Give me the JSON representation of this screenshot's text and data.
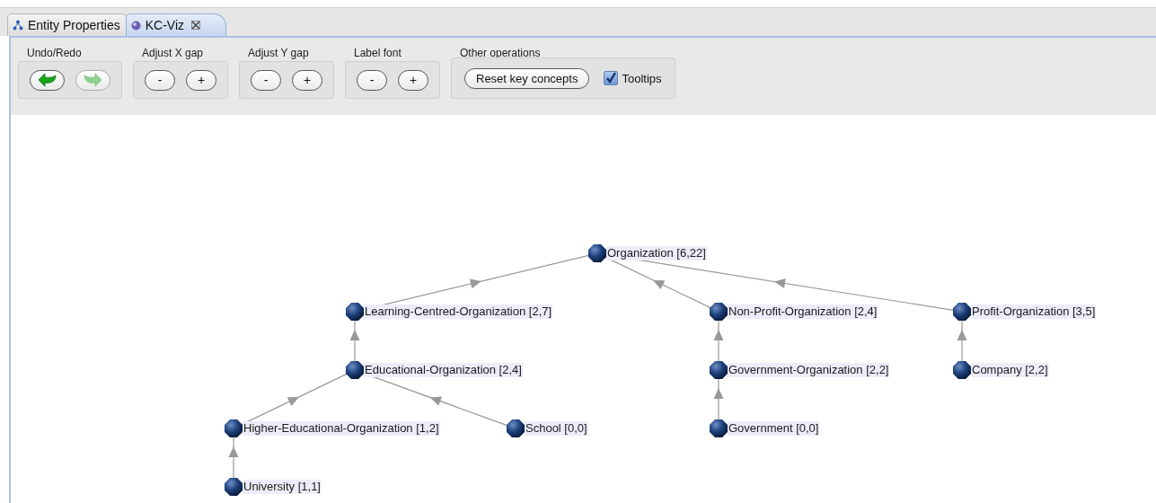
{
  "tabs": [
    {
      "label": "Entity Properties",
      "selected": false,
      "closable": false
    },
    {
      "label": "KC-Viz",
      "selected": true,
      "closable": true
    }
  ],
  "toolbar": {
    "groups": [
      {
        "title": "Undo/Redo",
        "controls": [
          {
            "kind": "undo",
            "disabled": false
          },
          {
            "kind": "redo",
            "disabled": true
          }
        ]
      },
      {
        "title": "Adjust X gap",
        "controls": [
          {
            "kind": "text",
            "label": "-",
            "disabled": false
          },
          {
            "kind": "text",
            "label": "+",
            "disabled": false
          }
        ]
      },
      {
        "title": "Adjust Y gap",
        "controls": [
          {
            "kind": "text",
            "label": "-",
            "disabled": false
          },
          {
            "kind": "text",
            "label": "+",
            "disabled": false
          }
        ]
      },
      {
        "title": "Label font",
        "controls": [
          {
            "kind": "text",
            "label": "-",
            "disabled": false
          },
          {
            "kind": "text",
            "label": "+",
            "disabled": false
          }
        ]
      },
      {
        "title": "Other operations",
        "controls": [
          {
            "kind": "text",
            "label": "Reset key concepts",
            "disabled": false
          },
          {
            "kind": "checkbox",
            "label": "Tooltips",
            "checked": true
          }
        ]
      }
    ]
  },
  "graph": {
    "root": {
      "label": "Organization [6,22]",
      "children": [
        {
          "label": "Learning-Centred-Organization [2,7]",
          "children": [
            {
              "label": "Educational-Organization [2,4]",
              "children": [
                {
                  "label": "Higher-Educational-Organization [1,2]",
                  "children": [
                    {
                      "label": "University [1,1]"
                    }
                  ]
                },
                {
                  "label": "School [0,0]"
                }
              ]
            }
          ]
        },
        {
          "label": "Non-Profit-Organization [2,4]",
          "children": [
            {
              "label": "Government-Organization [2,2]",
              "children": [
                {
                  "label": "Government [0,0]"
                }
              ]
            }
          ]
        },
        {
          "label": "Profit-Organization [3,5]",
          "children": [
            {
              "label": "Company [2,2]"
            }
          ]
        }
      ]
    }
  }
}
